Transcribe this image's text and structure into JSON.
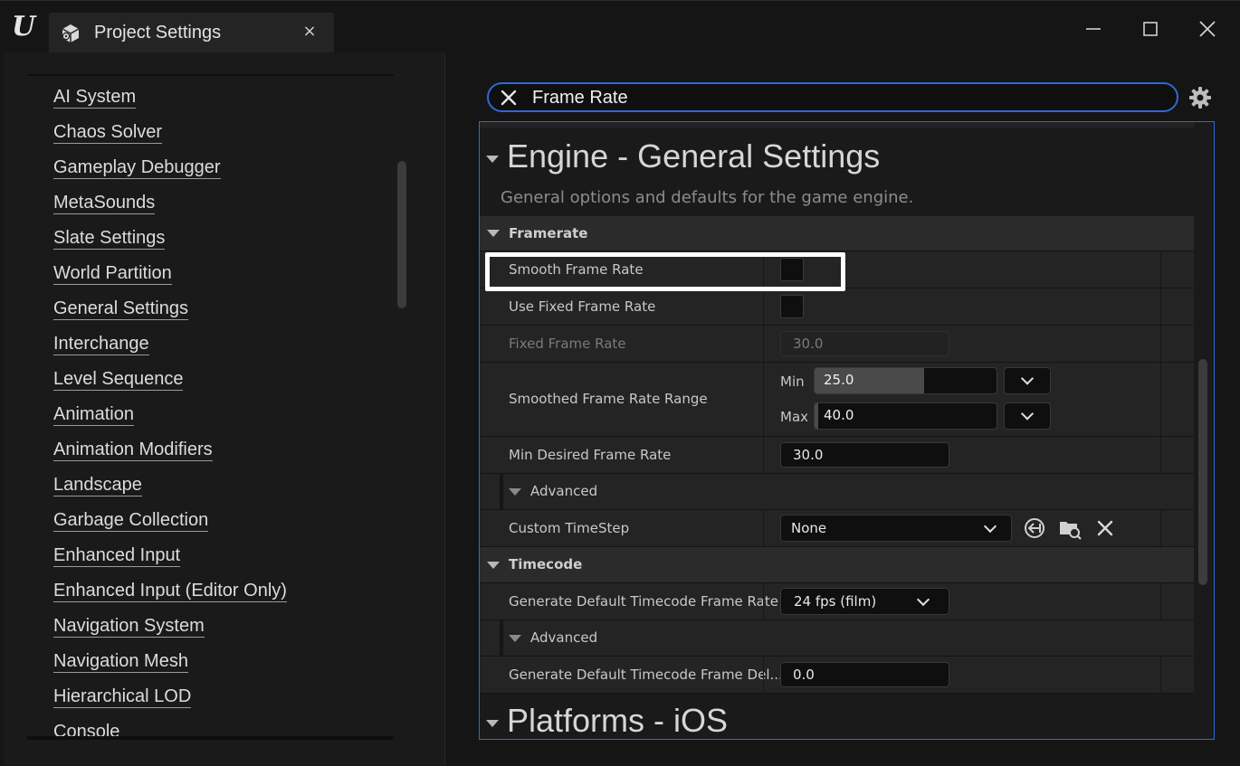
{
  "window": {
    "tab_title": "Project Settings",
    "tab_close": "×",
    "logo_icon": "unreal-engine-logo",
    "logo_text": "U"
  },
  "sidebar": {
    "items": [
      {
        "label": "AI System"
      },
      {
        "label": "Chaos Solver"
      },
      {
        "label": "Gameplay Debugger"
      },
      {
        "label": "MetaSounds"
      },
      {
        "label": "Slate Settings"
      },
      {
        "label": "World Partition"
      },
      {
        "label": "General Settings"
      },
      {
        "label": "Interchange"
      },
      {
        "label": "Level Sequence"
      },
      {
        "label": "Animation"
      },
      {
        "label": "Animation Modifiers"
      },
      {
        "label": "Landscape"
      },
      {
        "label": "Garbage Collection",
        "expandable": true
      },
      {
        "label": "Enhanced Input"
      },
      {
        "label": "Enhanced Input (Editor Only)"
      },
      {
        "label": "Navigation System"
      },
      {
        "label": "Navigation Mesh"
      },
      {
        "label": "Hierarchical LOD"
      },
      {
        "label": "Console"
      }
    ]
  },
  "search": {
    "value": "Frame Rate"
  },
  "details": {
    "category_title": "Engine - General Settings",
    "category_desc": "General options and defaults for the game engine.",
    "next_category_title": "Platforms - iOS",
    "framerate": {
      "section_label": "Framerate",
      "smooth_frame_rate_label": "Smooth Frame Rate",
      "use_fixed_frame_rate_label": "Use Fixed Frame Rate",
      "fixed_frame_rate_label": "Fixed Frame Rate",
      "fixed_frame_rate_value": "30.0",
      "smoothed_range_label": "Smoothed Frame Rate Range",
      "min_label": "Min",
      "min_value": "25.0",
      "min_fill": 0.6,
      "max_label": "Max",
      "max_value": "40.0",
      "max_fill": 0.02,
      "min_desired_label": "Min Desired Frame Rate",
      "min_desired_value": "30.0",
      "advanced_label": "Advanced",
      "custom_timestep_label": "Custom TimeStep",
      "custom_timestep_value": "None"
    },
    "timecode": {
      "section_label": "Timecode",
      "default_rate_label": "Generate Default Timecode Frame Rate",
      "default_rate_value": "24 fps (film)",
      "advanced_label": "Advanced",
      "frame_delay_label": "Generate Default Timecode Frame Del...",
      "frame_delay_value": "0.0"
    }
  },
  "colors": {
    "accent": "#2c6ad8",
    "highlight": "#ffffff",
    "panel_bg": "#1a1a1a"
  }
}
